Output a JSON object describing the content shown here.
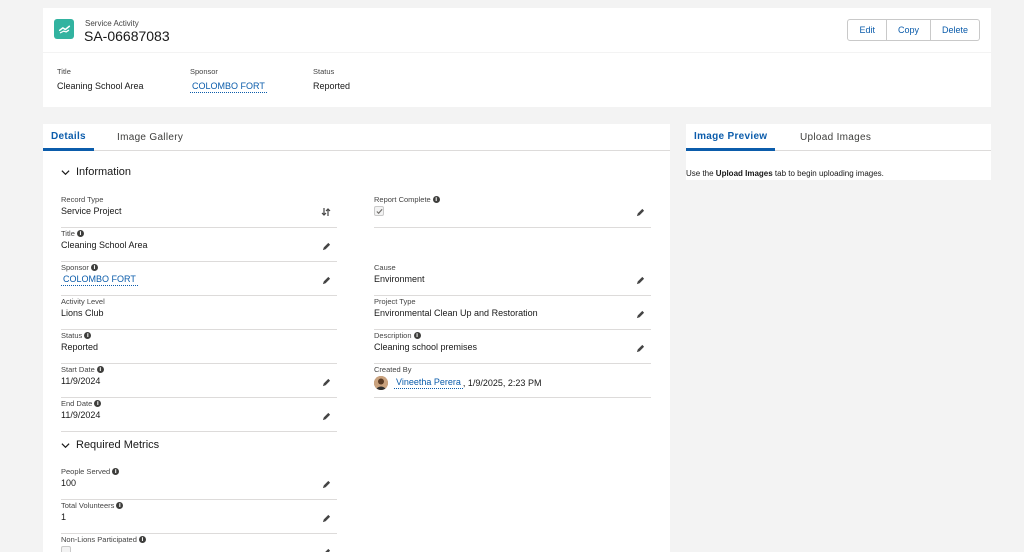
{
  "header": {
    "object_label": "Service Activity",
    "record_name": "SA-06687083",
    "buttons": {
      "edit": "Edit",
      "copy": "Copy",
      "delete": "Delete"
    }
  },
  "highlights": [
    {
      "label": "Title",
      "value": "Cleaning School Area"
    },
    {
      "label": "Sponsor",
      "value": "COLOMBO FORT"
    },
    {
      "label": "Status",
      "value": "Reported"
    }
  ],
  "main_tabs": {
    "details": "Details",
    "image_gallery": "Image Gallery"
  },
  "sections": {
    "information": "Information",
    "required_metrics": "Required Metrics"
  },
  "left_fields": {
    "record_type": {
      "label": "Record Type",
      "value": "Service Project"
    },
    "title": {
      "label": "Title",
      "value": "Cleaning School Area"
    },
    "sponsor": {
      "label": "Sponsor",
      "value": "COLOMBO FORT"
    },
    "activity_level": {
      "label": "Activity Level",
      "value": "Lions Club"
    },
    "status": {
      "label": "Status",
      "value": "Reported"
    },
    "start_date": {
      "label": "Start Date",
      "value": "11/9/2024"
    },
    "end_date": {
      "label": "End Date",
      "value": "11/9/2024"
    }
  },
  "right_fields": {
    "report_complete": {
      "label": "Report Complete",
      "checked": true
    },
    "cause": {
      "label": "Cause",
      "value": "Environment"
    },
    "project_type": {
      "label": "Project Type",
      "value": "Environmental Clean Up and Restoration"
    },
    "description": {
      "label": "Description",
      "value": "Cleaning school premises"
    },
    "created_by": {
      "label": "Created By",
      "user": "Vineetha Perera",
      "timestamp": ", 1/9/2025, 2:23 PM"
    }
  },
  "metrics": {
    "people_served": {
      "label": "People Served",
      "value": "100"
    },
    "total_volunteers": {
      "label": "Total Volunteers",
      "value": "1"
    },
    "non_lions": {
      "label": "Non-Lions Participated"
    }
  },
  "side_tabs": {
    "image_preview": "Image Preview",
    "upload_images": "Upload Images"
  },
  "side_message": {
    "prefix": "Use the ",
    "bold": "Upload Images",
    "suffix": " tab to begin uploading images."
  },
  "colors": {
    "brand_icon": "#32b3a0",
    "link": "#0b5cab",
    "background": "#f3f3f3"
  }
}
